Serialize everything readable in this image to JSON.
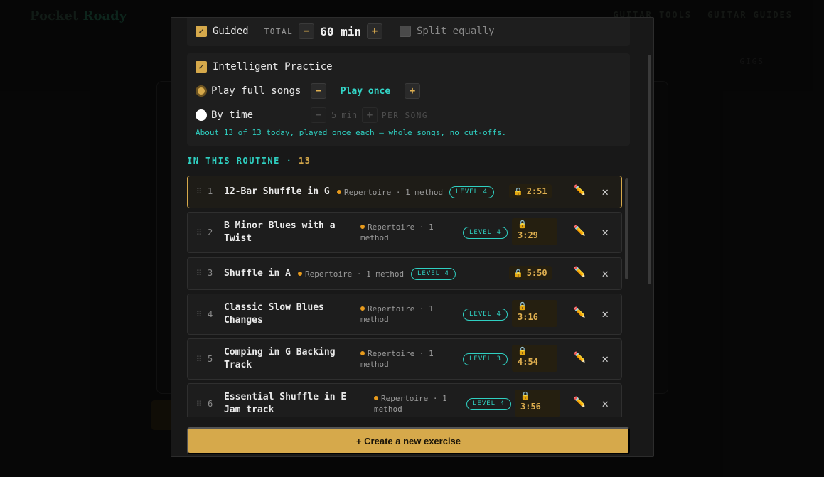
{
  "background": {
    "logo_a": "Pocket",
    "logo_b": "Roady",
    "nav": [
      "GUITAR TOOLS",
      "GUITAR GUIDES"
    ],
    "right_label": "GIGS"
  },
  "guided": {
    "label": "Guided",
    "total_label": "TOTAL",
    "minus": "−",
    "value": "60 min",
    "plus": "+",
    "split_label": "Split equally"
  },
  "intelligent": {
    "label": "Intelligent Practice",
    "full_songs_label": "Play full songs",
    "full_songs_value": "Play once",
    "by_time_label": "By time",
    "by_time_value": "5 min",
    "per_song": "PER SONG",
    "minus": "−",
    "plus": "+",
    "note": "About 13 of 13 today, played once each — whole songs, no cut-offs."
  },
  "routine": {
    "title": "IN THIS ROUTINE · ",
    "count": "13",
    "items": [
      {
        "num": "1",
        "name": "12-Bar Shuffle in G",
        "meta": "Repertoire · 1 method",
        "level": "LEVEL 4",
        "duration": "2:51"
      },
      {
        "num": "2",
        "name": "B Minor Blues with a Twist",
        "meta": "Repertoire · 1 method",
        "level": "LEVEL 4",
        "duration": "3:29"
      },
      {
        "num": "3",
        "name": "Shuffle in A",
        "meta": "Repertoire · 1 method",
        "level": "LEVEL 4",
        "duration": "5:50"
      },
      {
        "num": "4",
        "name": "Classic Slow Blues Changes",
        "meta": "Repertoire · 1 method",
        "level": "LEVEL 4",
        "duration": "3:16"
      },
      {
        "num": "5",
        "name": "Comping in G Backing Track",
        "meta": "Repertoire · 1 method",
        "level": "LEVEL 3",
        "duration": "4:54"
      },
      {
        "num": "6",
        "name": "Essential Shuffle in E Jam track",
        "meta": "Repertoire · 1 method",
        "level": "LEVEL 4",
        "duration": "3:56"
      }
    ]
  },
  "create_button": "+ Create a new exercise",
  "icons": {
    "drag": "drag-handle-icon",
    "lock": "lock-icon",
    "edit": "pencil-icon",
    "delete": "close-icon"
  }
}
